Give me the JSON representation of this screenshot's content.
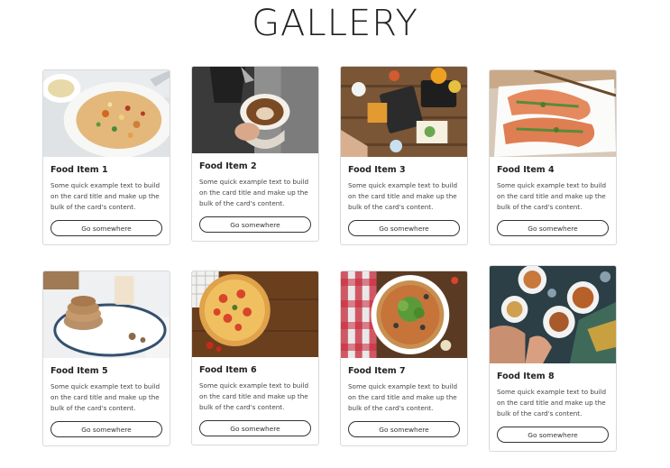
{
  "page": {
    "title": "GALLERY"
  },
  "cards": [
    {
      "title": "Food Item 1",
      "text": "Some quick example text to build on the card title and make up the bulk of the card's content.",
      "button": "Go somewhere",
      "image": "fried-rice-photo"
    },
    {
      "title": "Food Item 2",
      "text": "Some quick example text to build on the card title and make up the bulk of the card's content.",
      "button": "Go somewhere",
      "image": "latte-art-photo"
    },
    {
      "title": "Food Item 3",
      "text": "Some quick example text to build on the card title and make up the bulk of the card's content.",
      "button": "Go somewhere",
      "image": "table-spread-photo"
    },
    {
      "title": "Food Item 4",
      "text": "Some quick example text to build on the card title and make up the bulk of the card's content.",
      "button": "Go somewhere",
      "image": "grilled-salmon-photo"
    },
    {
      "title": "Food Item 5",
      "text": "Some quick example text to build on the card title and make up the bulk of the card's content.",
      "button": "Go somewhere",
      "image": "pancakes-photo"
    },
    {
      "title": "Food Item 6",
      "text": "Some quick example text to build on the card title and make up the bulk of the card's content.",
      "button": "Go somewhere",
      "image": "pizza-wood-photo"
    },
    {
      "title": "Food Item 7",
      "text": "Some quick example text to build on the card title and make up the bulk of the card's content.",
      "button": "Go somewhere",
      "image": "pizza-checkered-photo"
    },
    {
      "title": "Food Item 8",
      "text": "Some quick example text to build on the card title and make up the bulk of the card's content.",
      "button": "Go somewhere",
      "image": "shared-meal-photo"
    }
  ]
}
